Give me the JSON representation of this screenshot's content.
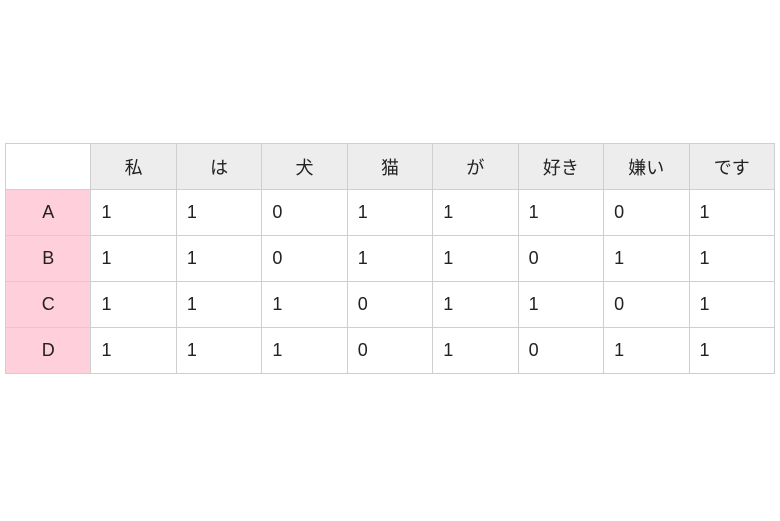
{
  "chart_data": {
    "type": "table",
    "columns": [
      "私",
      "は",
      "犬",
      "猫",
      "が",
      "好き",
      "嫌い",
      "です"
    ],
    "rows": [
      "A",
      "B",
      "C",
      "D"
    ],
    "values": [
      [
        1,
        1,
        0,
        1,
        1,
        1,
        0,
        1
      ],
      [
        1,
        1,
        0,
        1,
        1,
        0,
        1,
        1
      ],
      [
        1,
        1,
        1,
        0,
        1,
        1,
        0,
        1
      ],
      [
        1,
        1,
        1,
        0,
        1,
        0,
        1,
        1
      ]
    ]
  }
}
